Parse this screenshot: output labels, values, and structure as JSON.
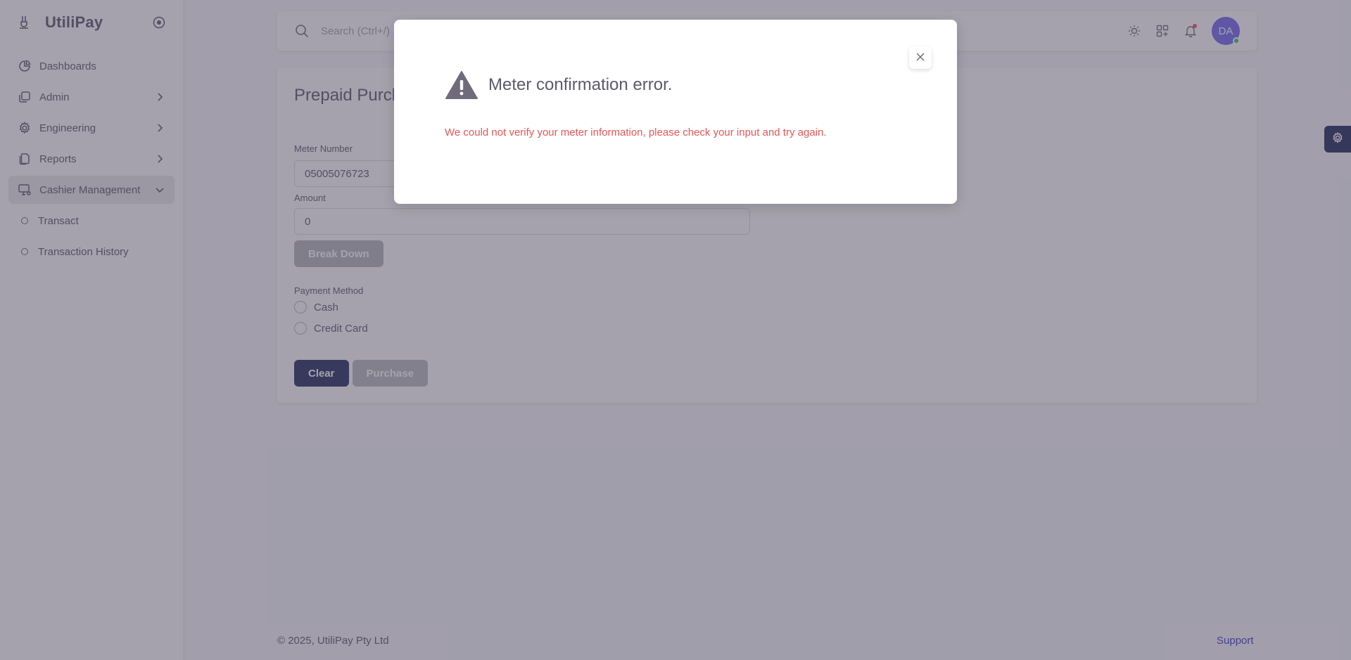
{
  "app": {
    "name": "UtiliPay"
  },
  "sidebar": {
    "items": [
      {
        "label": "Dashboards"
      },
      {
        "label": "Admin"
      },
      {
        "label": "Engineering"
      },
      {
        "label": "Reports"
      },
      {
        "label": "Cashier Management"
      }
    ],
    "subitems": [
      {
        "label": "Transact"
      },
      {
        "label": "Transaction History"
      }
    ]
  },
  "topbar": {
    "search_placeholder": "Search (Ctrl+/)",
    "avatar_initials": "DA"
  },
  "page": {
    "title": "Prepaid Purchase",
    "meter_label": "Meter Number",
    "meter_value": "05005076723",
    "amount_label": "Amount",
    "amount_value": "0",
    "breakdown_label": "Break Down",
    "payment_label": "Payment Method",
    "payment_options": [
      "Cash",
      "Credit Card"
    ],
    "clear_label": "Clear",
    "purchase_label": "Purchase"
  },
  "footer": {
    "copyright": "© 2025, UtiliPay Pty Ltd",
    "support": "Support"
  },
  "modal": {
    "title": "Meter confirmation error.",
    "message": "We could not verify your meter information, please check your input and try again.",
    "close_icon": "close-icon",
    "icon": "warning-icon"
  },
  "colors": {
    "primary": "#222f5e",
    "error": "#ea5455",
    "overlay": "rgba(75,70,92,0.5)"
  }
}
